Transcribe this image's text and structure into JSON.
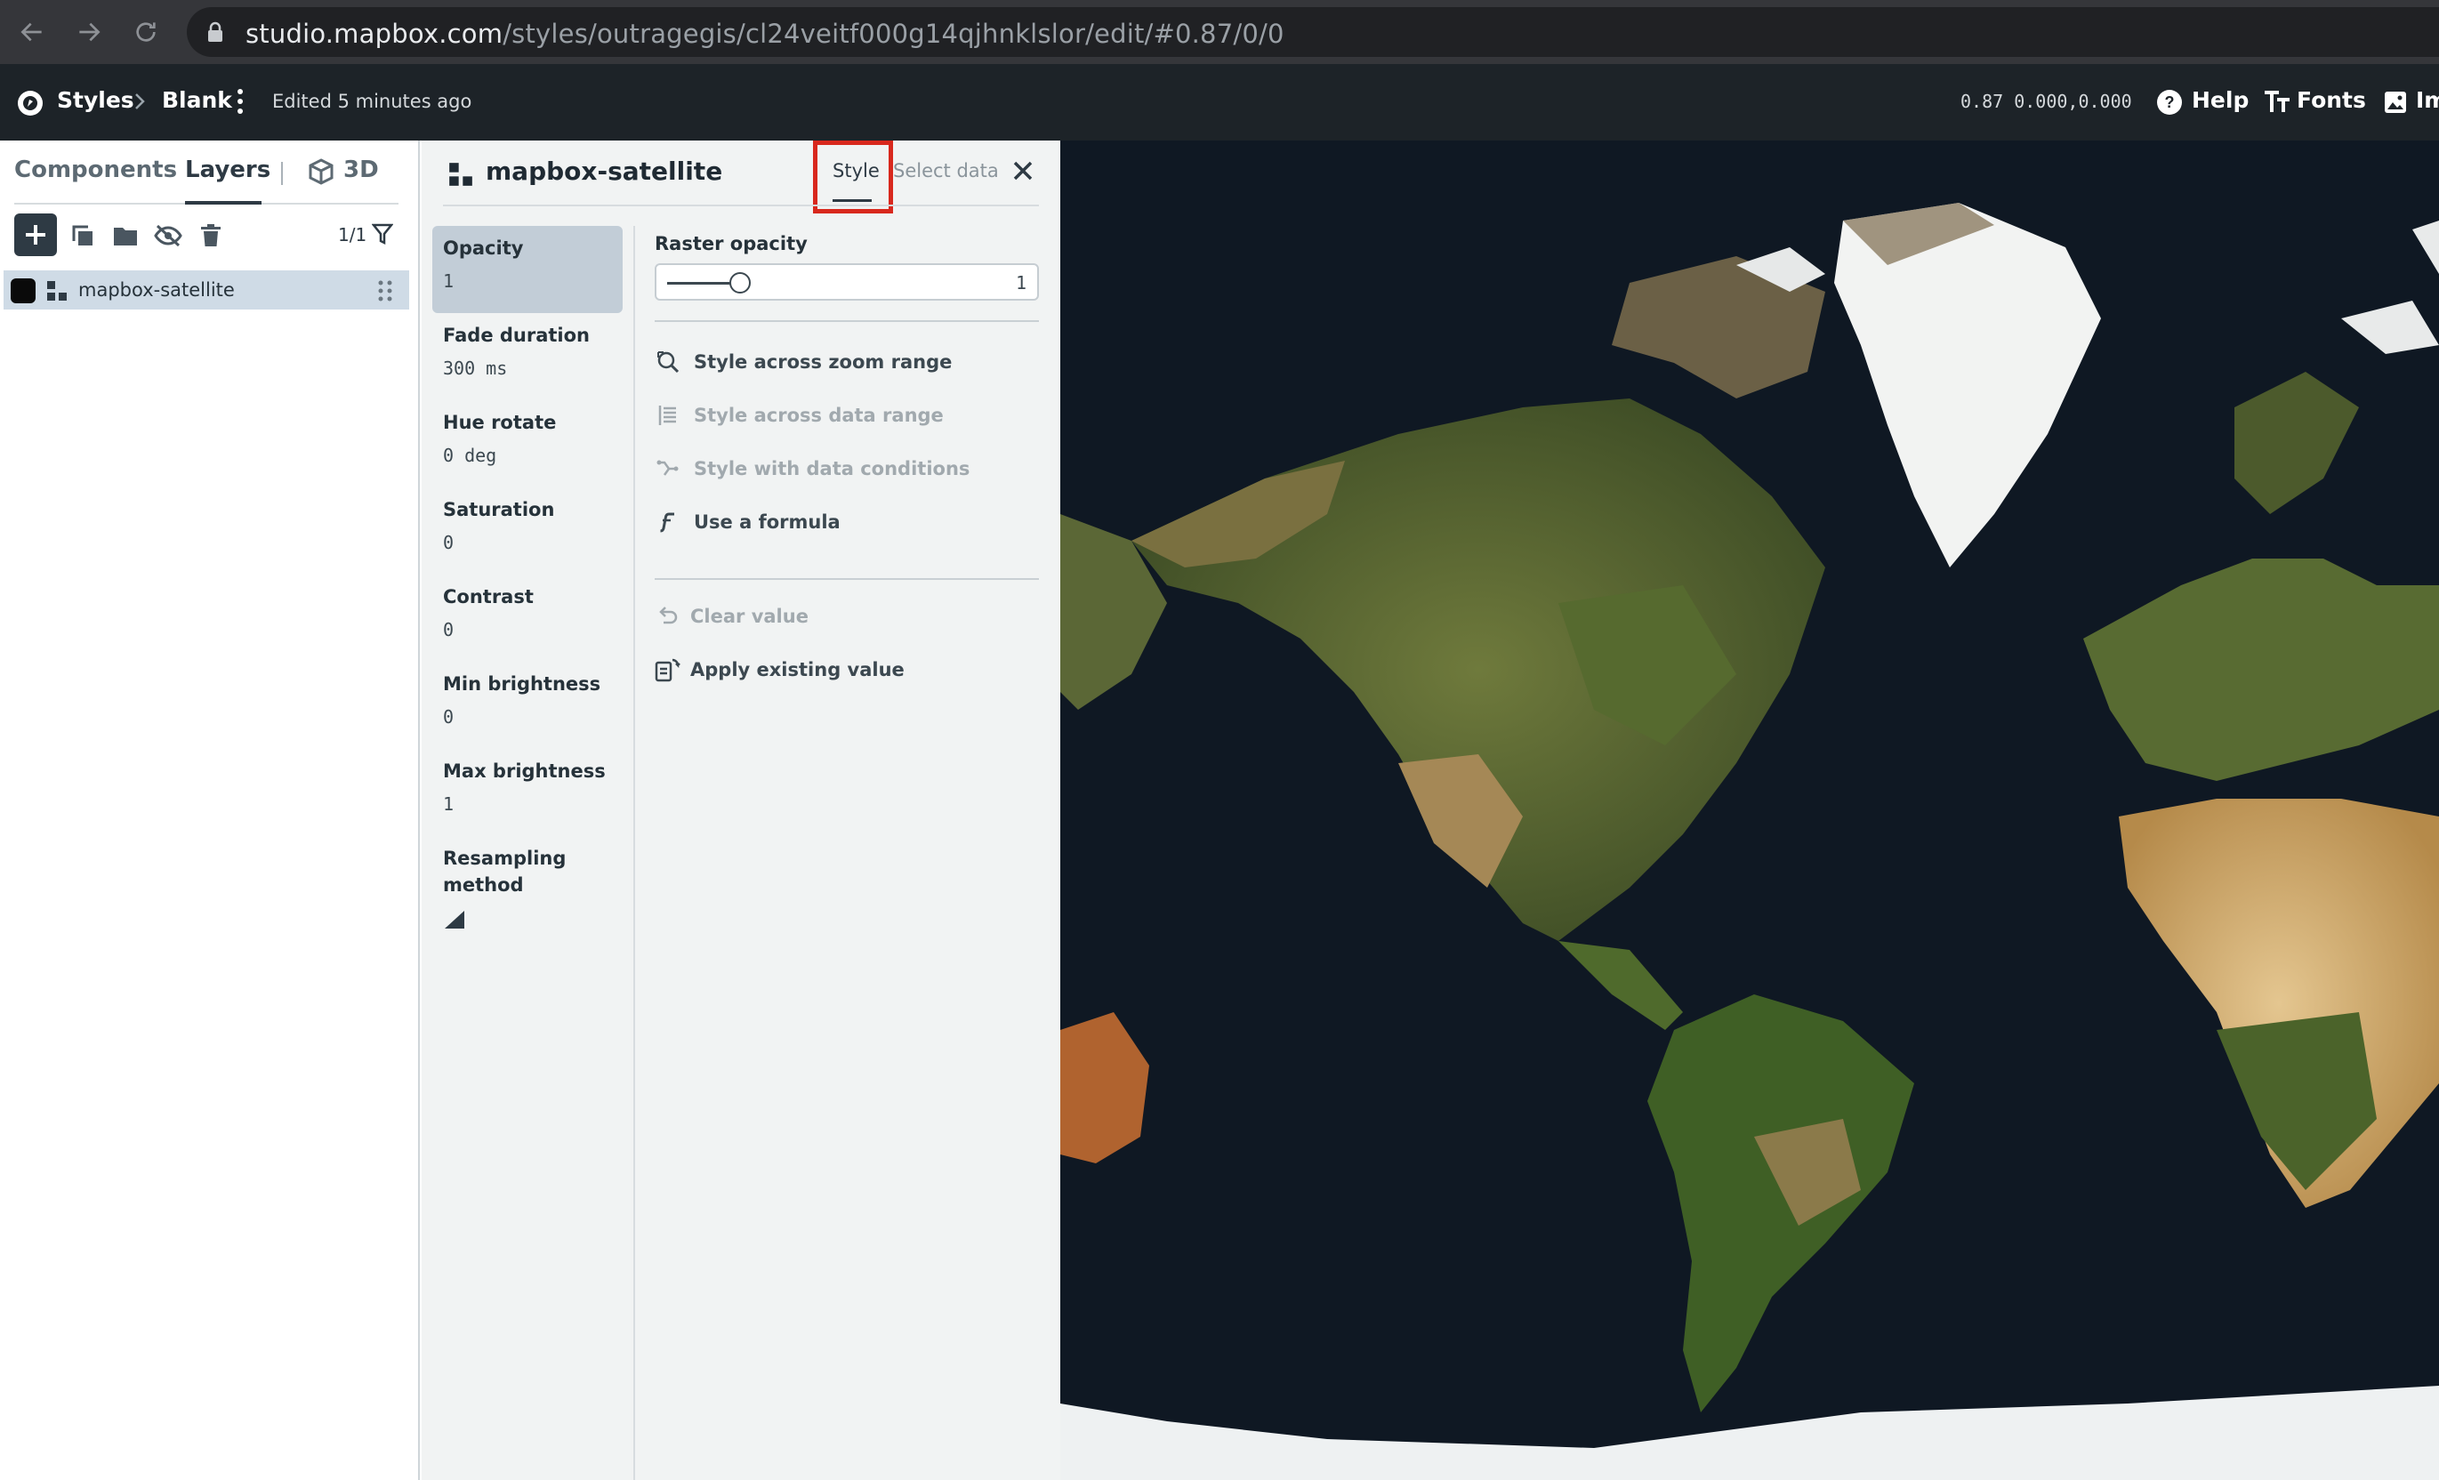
{
  "browser": {
    "url_host": "studio.mapbox.com",
    "url_path": "/styles/outragegis/cl24veitf000g14qjhnklslor/edit/#0.87/0/0"
  },
  "header": {
    "styles_label": "Styles",
    "style_name": "Blank",
    "edited_text": "Edited 5 minutes ago",
    "map_position": "0.87 0.000,0.000",
    "help_label": "Help",
    "fonts_label": "Fonts",
    "images_label_partial": "Im"
  },
  "left_panel": {
    "tabs": {
      "components": "Components",
      "layers": "Layers",
      "three_d": "3D"
    },
    "layer_count": "1/1",
    "layers": [
      {
        "name": "mapbox-satellite"
      }
    ]
  },
  "layer_editor": {
    "title": "mapbox-satellite",
    "tabs": {
      "style": "Style",
      "select_data": "Select data"
    },
    "properties": [
      {
        "label": "Opacity",
        "value": "1",
        "active": true
      },
      {
        "label": "Fade duration",
        "value": "300 ms"
      },
      {
        "label": "Hue rotate",
        "value": "0 deg"
      },
      {
        "label": "Saturation",
        "value": "0"
      },
      {
        "label": "Contrast",
        "value": "0"
      },
      {
        "label": "Min brightness",
        "value": "0"
      },
      {
        "label": "Max brightness",
        "value": "1"
      },
      {
        "label": "Resampling method",
        "value": ""
      }
    ],
    "detail": {
      "label": "Raster opacity",
      "slider_value": "1",
      "slider_fraction": 0.22,
      "options": [
        {
          "label": "Style across zoom range",
          "enabled": true
        },
        {
          "label": "Style across data range",
          "enabled": false
        },
        {
          "label": "Style with data conditions",
          "enabled": false
        },
        {
          "label": "Use a formula",
          "enabled": true
        }
      ],
      "actions": [
        {
          "label": "Clear value",
          "enabled": false
        },
        {
          "label": "Apply existing value",
          "enabled": true
        }
      ]
    }
  },
  "colors": {
    "accent": "#2e3a44",
    "highlight_box": "#d8281d",
    "header_bg": "#1d2328"
  }
}
